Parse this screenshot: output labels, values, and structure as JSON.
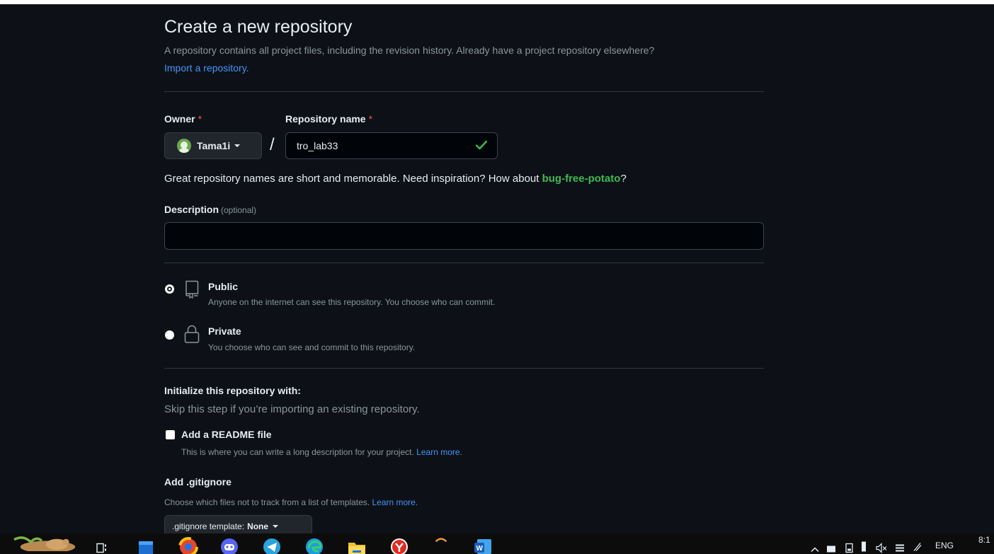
{
  "page": {
    "title": "Create a new repository",
    "subtitle": "A repository contains all project files, including the revision history. Already have a project repository elsewhere?",
    "import_link": "Import a repository."
  },
  "owner": {
    "label": "Owner",
    "required_mark": "*",
    "value": "Tama1i"
  },
  "repo_name": {
    "label": "Repository name",
    "required_mark": "*",
    "value": "tro_lab33",
    "separator": "/"
  },
  "name_hint": {
    "text": "Great repository names are short and memorable. Need inspiration? How about ",
    "suggestion": "bug-free-potato",
    "end": "?"
  },
  "description": {
    "label": "Description",
    "optional": "(optional)",
    "value": ""
  },
  "visibility": {
    "options": [
      {
        "title": "Public",
        "desc": "Anyone on the internet can see this repository. You choose who can commit.",
        "selected": true,
        "icon": "repo-icon"
      },
      {
        "title": "Private",
        "desc": "You choose who can see and commit to this repository.",
        "selected": false,
        "icon": "lock-icon"
      }
    ]
  },
  "init": {
    "title": "Initialize this repository with:",
    "subtitle": "Skip this step if you’re importing an existing repository.",
    "readme_label": "Add a README file",
    "readme_desc": "This is where you can write a long description for your project.",
    "readme_link": "Learn more.",
    "readme_checked": false
  },
  "gitignore": {
    "title": "Add .gitignore",
    "desc": "Choose which files not to track from a list of templates.",
    "link": "Learn more.",
    "button_label": ".gitignore template:",
    "button_value": "None"
  },
  "taskbar": {
    "language": "ENG",
    "clock": "8:1",
    "icons": [
      "taskview-icon",
      "app-icon",
      "browser-icon",
      "discord-icon",
      "telegram-icon",
      "edge-icon",
      "folder-icon",
      "yandex-icon",
      "app-icon-2",
      "word-icon"
    ]
  },
  "colors": {
    "background": "#0d1117",
    "accent_link": "#4493f8",
    "success": "#3fb950",
    "required": "#f85149"
  }
}
